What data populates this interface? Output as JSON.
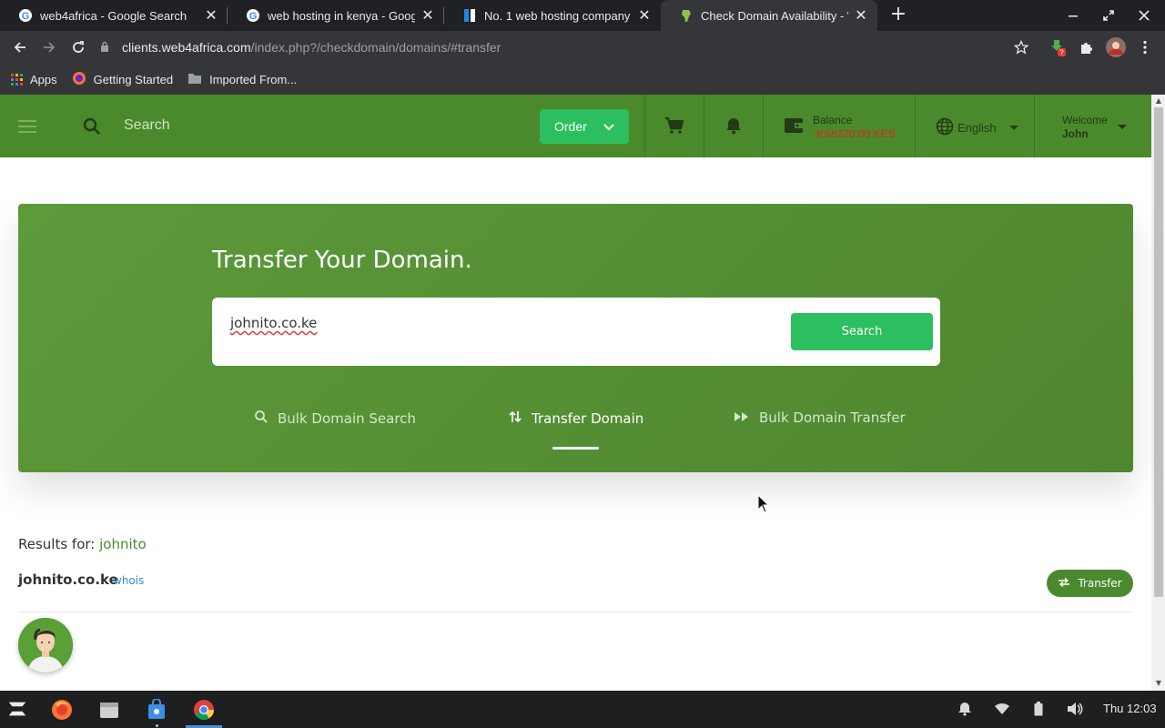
{
  "browser": {
    "tabs": [
      {
        "title": "web4africa - Google Search",
        "favicon": "google-icon",
        "active": false
      },
      {
        "title": "web hosting in kenya - Goog",
        "favicon": "google-icon",
        "active": false
      },
      {
        "title": "No. 1 web hosting company",
        "favicon": "web4africa-icon",
        "active": false
      },
      {
        "title": "Check Domain Availability - W",
        "favicon": "africa-map-icon",
        "active": true
      }
    ],
    "url_host": "clients.web4africa.com",
    "url_path": "/index.php?/checkdomain/domains/#transfer",
    "bookmarks": [
      {
        "label": "Apps",
        "icon": "apps-grid-icon"
      },
      {
        "label": "Getting Started",
        "icon": "firefox-icon"
      },
      {
        "label": "Imported From...",
        "icon": "folder-icon"
      }
    ],
    "extension_badge": "?"
  },
  "header": {
    "search_placeholder": "Search",
    "order_label": "Order",
    "balance_label": "Balance",
    "balance_value": "-KSh220.00 KES",
    "language": "English",
    "welcome_label": "Welcome",
    "user_name": "John"
  },
  "hero": {
    "title": "Transfer Your Domain.",
    "search_value": "johnito.co.ke",
    "search_button": "Search",
    "tabs": [
      {
        "label": "Bulk Domain Search",
        "icon": "search-icon",
        "active": false
      },
      {
        "label": "Transfer Domain",
        "icon": "transfer-arrows-icon",
        "active": true
      },
      {
        "label": "Bulk Domain Transfer",
        "icon": "fast-forward-icon",
        "active": false
      }
    ]
  },
  "results": {
    "label": "Results for:",
    "term": "johnito",
    "domain": "johnito.co.ke",
    "whois": "whois",
    "transfer_button": "Transfer"
  },
  "taskbar": {
    "clock": "Thu 12:03"
  },
  "colors": {
    "brand_green": "#4a8a2c",
    "button_green": "#2bbf5f",
    "balance_red": "#e02424",
    "link_blue": "#3a8fd0"
  }
}
